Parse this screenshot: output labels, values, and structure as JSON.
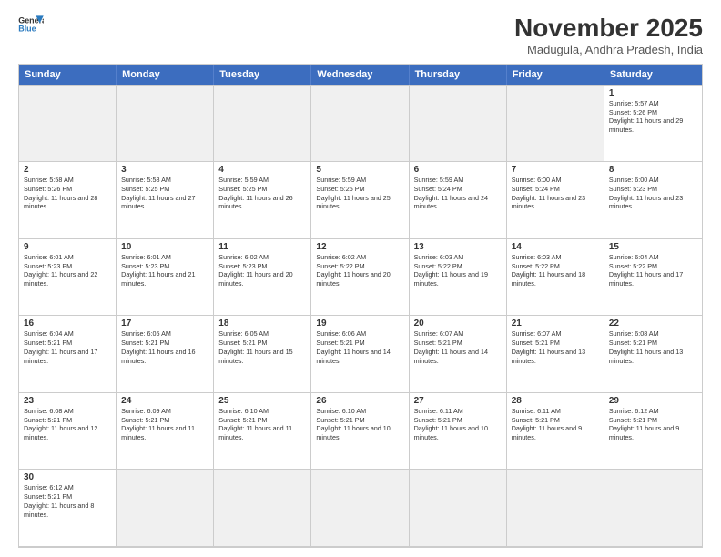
{
  "header": {
    "logo_line1": "General",
    "logo_line2": "Blue",
    "month_title": "November 2025",
    "location": "Madugula, Andhra Pradesh, India"
  },
  "day_headers": [
    "Sunday",
    "Monday",
    "Tuesday",
    "Wednesday",
    "Thursday",
    "Friday",
    "Saturday"
  ],
  "weeks": [
    [
      {
        "date": "",
        "empty": true
      },
      {
        "date": "",
        "empty": true
      },
      {
        "date": "",
        "empty": true
      },
      {
        "date": "",
        "empty": true
      },
      {
        "date": "",
        "empty": true
      },
      {
        "date": "",
        "empty": true
      },
      {
        "date": "1",
        "sunrise": "Sunrise: 5:57 AM",
        "sunset": "Sunset: 5:26 PM",
        "daylight": "Daylight: 11 hours and 29 minutes."
      }
    ],
    [
      {
        "date": "2",
        "sunrise": "Sunrise: 5:58 AM",
        "sunset": "Sunset: 5:26 PM",
        "daylight": "Daylight: 11 hours and 28 minutes."
      },
      {
        "date": "3",
        "sunrise": "Sunrise: 5:58 AM",
        "sunset": "Sunset: 5:25 PM",
        "daylight": "Daylight: 11 hours and 27 minutes."
      },
      {
        "date": "4",
        "sunrise": "Sunrise: 5:59 AM",
        "sunset": "Sunset: 5:25 PM",
        "daylight": "Daylight: 11 hours and 26 minutes."
      },
      {
        "date": "5",
        "sunrise": "Sunrise: 5:59 AM",
        "sunset": "Sunset: 5:25 PM",
        "daylight": "Daylight: 11 hours and 25 minutes."
      },
      {
        "date": "6",
        "sunrise": "Sunrise: 5:59 AM",
        "sunset": "Sunset: 5:24 PM",
        "daylight": "Daylight: 11 hours and 24 minutes."
      },
      {
        "date": "7",
        "sunrise": "Sunrise: 6:00 AM",
        "sunset": "Sunset: 5:24 PM",
        "daylight": "Daylight: 11 hours and 23 minutes."
      },
      {
        "date": "8",
        "sunrise": "Sunrise: 6:00 AM",
        "sunset": "Sunset: 5:23 PM",
        "daylight": "Daylight: 11 hours and 23 minutes."
      }
    ],
    [
      {
        "date": "9",
        "sunrise": "Sunrise: 6:01 AM",
        "sunset": "Sunset: 5:23 PM",
        "daylight": "Daylight: 11 hours and 22 minutes."
      },
      {
        "date": "10",
        "sunrise": "Sunrise: 6:01 AM",
        "sunset": "Sunset: 5:23 PM",
        "daylight": "Daylight: 11 hours and 21 minutes."
      },
      {
        "date": "11",
        "sunrise": "Sunrise: 6:02 AM",
        "sunset": "Sunset: 5:23 PM",
        "daylight": "Daylight: 11 hours and 20 minutes."
      },
      {
        "date": "12",
        "sunrise": "Sunrise: 6:02 AM",
        "sunset": "Sunset: 5:22 PM",
        "daylight": "Daylight: 11 hours and 20 minutes."
      },
      {
        "date": "13",
        "sunrise": "Sunrise: 6:03 AM",
        "sunset": "Sunset: 5:22 PM",
        "daylight": "Daylight: 11 hours and 19 minutes."
      },
      {
        "date": "14",
        "sunrise": "Sunrise: 6:03 AM",
        "sunset": "Sunset: 5:22 PM",
        "daylight": "Daylight: 11 hours and 18 minutes."
      },
      {
        "date": "15",
        "sunrise": "Sunrise: 6:04 AM",
        "sunset": "Sunset: 5:22 PM",
        "daylight": "Daylight: 11 hours and 17 minutes."
      }
    ],
    [
      {
        "date": "16",
        "sunrise": "Sunrise: 6:04 AM",
        "sunset": "Sunset: 5:21 PM",
        "daylight": "Daylight: 11 hours and 17 minutes."
      },
      {
        "date": "17",
        "sunrise": "Sunrise: 6:05 AM",
        "sunset": "Sunset: 5:21 PM",
        "daylight": "Daylight: 11 hours and 16 minutes."
      },
      {
        "date": "18",
        "sunrise": "Sunrise: 6:05 AM",
        "sunset": "Sunset: 5:21 PM",
        "daylight": "Daylight: 11 hours and 15 minutes."
      },
      {
        "date": "19",
        "sunrise": "Sunrise: 6:06 AM",
        "sunset": "Sunset: 5:21 PM",
        "daylight": "Daylight: 11 hours and 14 minutes."
      },
      {
        "date": "20",
        "sunrise": "Sunrise: 6:07 AM",
        "sunset": "Sunset: 5:21 PM",
        "daylight": "Daylight: 11 hours and 14 minutes."
      },
      {
        "date": "21",
        "sunrise": "Sunrise: 6:07 AM",
        "sunset": "Sunset: 5:21 PM",
        "daylight": "Daylight: 11 hours and 13 minutes."
      },
      {
        "date": "22",
        "sunrise": "Sunrise: 6:08 AM",
        "sunset": "Sunset: 5:21 PM",
        "daylight": "Daylight: 11 hours and 13 minutes."
      }
    ],
    [
      {
        "date": "23",
        "sunrise": "Sunrise: 6:08 AM",
        "sunset": "Sunset: 5:21 PM",
        "daylight": "Daylight: 11 hours and 12 minutes."
      },
      {
        "date": "24",
        "sunrise": "Sunrise: 6:09 AM",
        "sunset": "Sunset: 5:21 PM",
        "daylight": "Daylight: 11 hours and 11 minutes."
      },
      {
        "date": "25",
        "sunrise": "Sunrise: 6:10 AM",
        "sunset": "Sunset: 5:21 PM",
        "daylight": "Daylight: 11 hours and 11 minutes."
      },
      {
        "date": "26",
        "sunrise": "Sunrise: 6:10 AM",
        "sunset": "Sunset: 5:21 PM",
        "daylight": "Daylight: 11 hours and 10 minutes."
      },
      {
        "date": "27",
        "sunrise": "Sunrise: 6:11 AM",
        "sunset": "Sunset: 5:21 PM",
        "daylight": "Daylight: 11 hours and 10 minutes."
      },
      {
        "date": "28",
        "sunrise": "Sunrise: 6:11 AM",
        "sunset": "Sunset: 5:21 PM",
        "daylight": "Daylight: 11 hours and 9 minutes."
      },
      {
        "date": "29",
        "sunrise": "Sunrise: 6:12 AM",
        "sunset": "Sunset: 5:21 PM",
        "daylight": "Daylight: 11 hours and 9 minutes."
      }
    ],
    [
      {
        "date": "30",
        "sunrise": "Sunrise: 6:12 AM",
        "sunset": "Sunset: 5:21 PM",
        "daylight": "Daylight: 11 hours and 8 minutes."
      },
      {
        "date": "",
        "empty": true
      },
      {
        "date": "",
        "empty": true
      },
      {
        "date": "",
        "empty": true
      },
      {
        "date": "",
        "empty": true
      },
      {
        "date": "",
        "empty": true
      },
      {
        "date": "",
        "empty": true
      }
    ]
  ]
}
